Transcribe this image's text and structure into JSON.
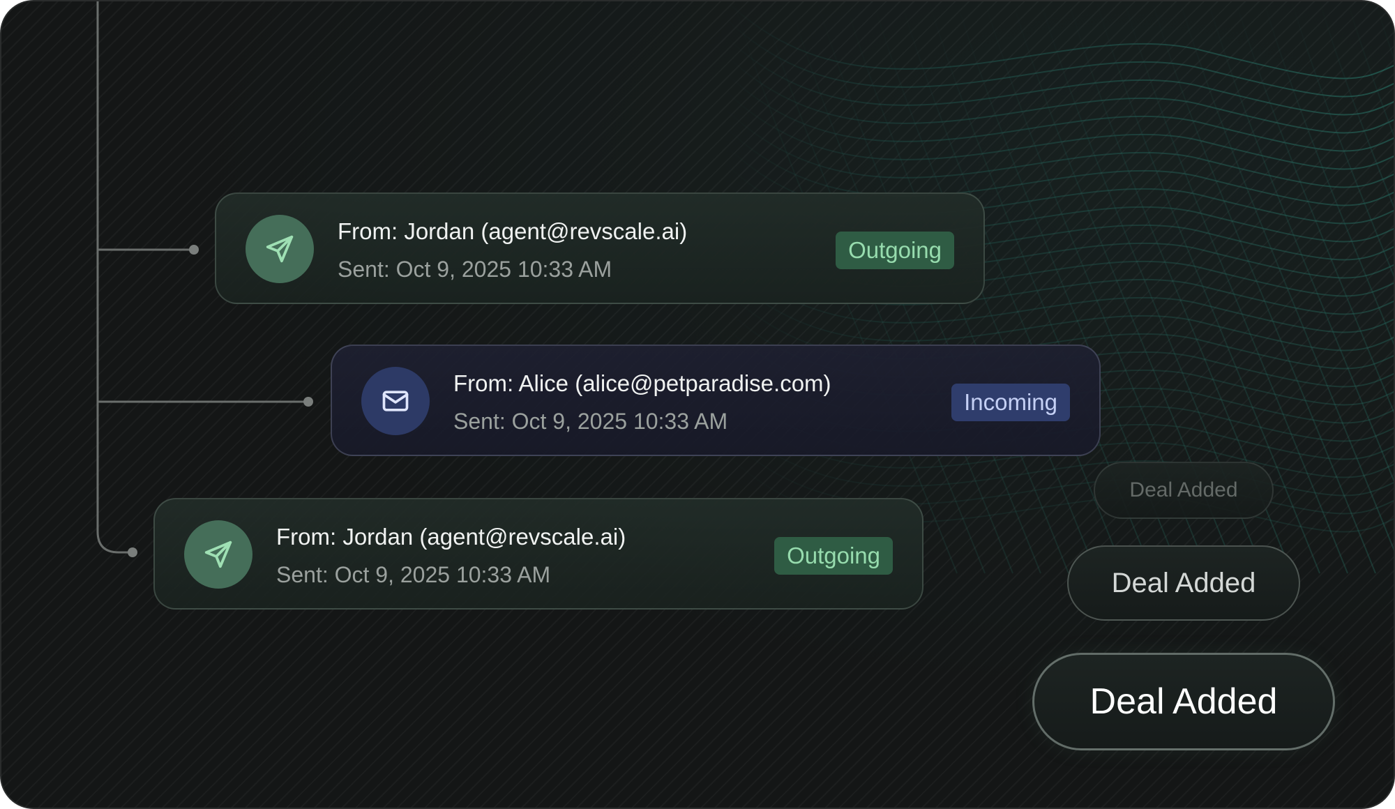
{
  "timeline": {
    "items": [
      {
        "direction": "outgoing",
        "icon": "paper-plane-icon",
        "from": "From: Jordan (agent@revscale.ai)",
        "sent": "Sent: Oct 9, 2025 10:33 AM",
        "badge": "Outgoing"
      },
      {
        "direction": "incoming",
        "icon": "mail-icon",
        "from": "From: Alice (alice@petparadise.com)",
        "sent": "Sent: Oct 9, 2025 10:33 AM",
        "badge": "Incoming"
      },
      {
        "direction": "outgoing",
        "icon": "paper-plane-icon",
        "from": "From: Jordan (agent@revscale.ai)",
        "sent": "Sent: Oct 9, 2025 10:33 AM",
        "badge": "Outgoing"
      }
    ]
  },
  "deal_buttons": {
    "small": "Deal Added",
    "medium": "Deal Added",
    "large": "Deal Added"
  },
  "colors": {
    "background": "#141616",
    "outgoing_accent": "#97dcae",
    "incoming_accent": "#c5d0f5",
    "mesh": "#1f5a52"
  }
}
